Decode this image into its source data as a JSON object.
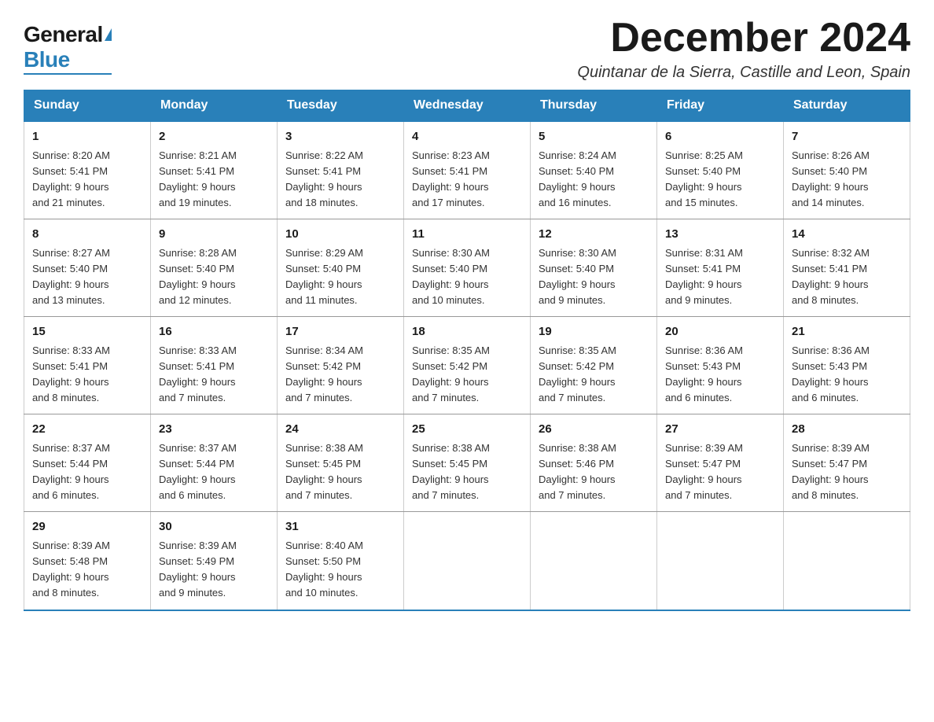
{
  "logo": {
    "general": "General",
    "blue": "Blue"
  },
  "header": {
    "month_year": "December 2024",
    "location": "Quintanar de la Sierra, Castille and Leon, Spain"
  },
  "days_of_week": [
    "Sunday",
    "Monday",
    "Tuesday",
    "Wednesday",
    "Thursday",
    "Friday",
    "Saturday"
  ],
  "weeks": [
    {
      "days": [
        {
          "num": "1",
          "sunrise": "8:20 AM",
          "sunset": "5:41 PM",
          "daylight": "9 hours and 21 minutes."
        },
        {
          "num": "2",
          "sunrise": "8:21 AM",
          "sunset": "5:41 PM",
          "daylight": "9 hours and 19 minutes."
        },
        {
          "num": "3",
          "sunrise": "8:22 AM",
          "sunset": "5:41 PM",
          "daylight": "9 hours and 18 minutes."
        },
        {
          "num": "4",
          "sunrise": "8:23 AM",
          "sunset": "5:41 PM",
          "daylight": "9 hours and 17 minutes."
        },
        {
          "num": "5",
          "sunrise": "8:24 AM",
          "sunset": "5:40 PM",
          "daylight": "9 hours and 16 minutes."
        },
        {
          "num": "6",
          "sunrise": "8:25 AM",
          "sunset": "5:40 PM",
          "daylight": "9 hours and 15 minutes."
        },
        {
          "num": "7",
          "sunrise": "8:26 AM",
          "sunset": "5:40 PM",
          "daylight": "9 hours and 14 minutes."
        }
      ]
    },
    {
      "days": [
        {
          "num": "8",
          "sunrise": "8:27 AM",
          "sunset": "5:40 PM",
          "daylight": "9 hours and 13 minutes."
        },
        {
          "num": "9",
          "sunrise": "8:28 AM",
          "sunset": "5:40 PM",
          "daylight": "9 hours and 12 minutes."
        },
        {
          "num": "10",
          "sunrise": "8:29 AM",
          "sunset": "5:40 PM",
          "daylight": "9 hours and 11 minutes."
        },
        {
          "num": "11",
          "sunrise": "8:30 AM",
          "sunset": "5:40 PM",
          "daylight": "9 hours and 10 minutes."
        },
        {
          "num": "12",
          "sunrise": "8:30 AM",
          "sunset": "5:40 PM",
          "daylight": "9 hours and 9 minutes."
        },
        {
          "num": "13",
          "sunrise": "8:31 AM",
          "sunset": "5:41 PM",
          "daylight": "9 hours and 9 minutes."
        },
        {
          "num": "14",
          "sunrise": "8:32 AM",
          "sunset": "5:41 PM",
          "daylight": "9 hours and 8 minutes."
        }
      ]
    },
    {
      "days": [
        {
          "num": "15",
          "sunrise": "8:33 AM",
          "sunset": "5:41 PM",
          "daylight": "9 hours and 8 minutes."
        },
        {
          "num": "16",
          "sunrise": "8:33 AM",
          "sunset": "5:41 PM",
          "daylight": "9 hours and 7 minutes."
        },
        {
          "num": "17",
          "sunrise": "8:34 AM",
          "sunset": "5:42 PM",
          "daylight": "9 hours and 7 minutes."
        },
        {
          "num": "18",
          "sunrise": "8:35 AM",
          "sunset": "5:42 PM",
          "daylight": "9 hours and 7 minutes."
        },
        {
          "num": "19",
          "sunrise": "8:35 AM",
          "sunset": "5:42 PM",
          "daylight": "9 hours and 7 minutes."
        },
        {
          "num": "20",
          "sunrise": "8:36 AM",
          "sunset": "5:43 PM",
          "daylight": "9 hours and 6 minutes."
        },
        {
          "num": "21",
          "sunrise": "8:36 AM",
          "sunset": "5:43 PM",
          "daylight": "9 hours and 6 minutes."
        }
      ]
    },
    {
      "days": [
        {
          "num": "22",
          "sunrise": "8:37 AM",
          "sunset": "5:44 PM",
          "daylight": "9 hours and 6 minutes."
        },
        {
          "num": "23",
          "sunrise": "8:37 AM",
          "sunset": "5:44 PM",
          "daylight": "9 hours and 6 minutes."
        },
        {
          "num": "24",
          "sunrise": "8:38 AM",
          "sunset": "5:45 PM",
          "daylight": "9 hours and 7 minutes."
        },
        {
          "num": "25",
          "sunrise": "8:38 AM",
          "sunset": "5:45 PM",
          "daylight": "9 hours and 7 minutes."
        },
        {
          "num": "26",
          "sunrise": "8:38 AM",
          "sunset": "5:46 PM",
          "daylight": "9 hours and 7 minutes."
        },
        {
          "num": "27",
          "sunrise": "8:39 AM",
          "sunset": "5:47 PM",
          "daylight": "9 hours and 7 minutes."
        },
        {
          "num": "28",
          "sunrise": "8:39 AM",
          "sunset": "5:47 PM",
          "daylight": "9 hours and 8 minutes."
        }
      ]
    },
    {
      "days": [
        {
          "num": "29",
          "sunrise": "8:39 AM",
          "sunset": "5:48 PM",
          "daylight": "9 hours and 8 minutes."
        },
        {
          "num": "30",
          "sunrise": "8:39 AM",
          "sunset": "5:49 PM",
          "daylight": "9 hours and 9 minutes."
        },
        {
          "num": "31",
          "sunrise": "8:40 AM",
          "sunset": "5:50 PM",
          "daylight": "9 hours and 10 minutes."
        },
        null,
        null,
        null,
        null
      ]
    }
  ],
  "labels": {
    "sunrise": "Sunrise:",
    "sunset": "Sunset:",
    "daylight": "Daylight:"
  }
}
